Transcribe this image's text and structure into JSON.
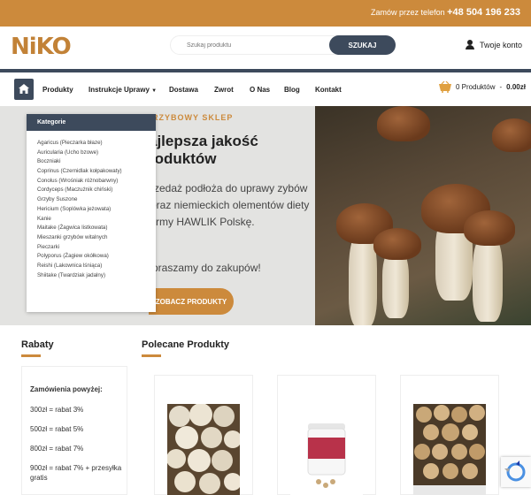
{
  "topbar": {
    "phone_label": "Zamów przez telefon",
    "phone_number": "+48 504 196 233"
  },
  "header": {
    "logo": "NiKO",
    "search_placeholder": "Szukaj produktu",
    "search_button": "SZUKAJ",
    "account_label": "Twoje konto",
    "icons": {
      "account": "user-icon"
    }
  },
  "nav": {
    "items": [
      "Produkty",
      "Instrukcje Uprawy",
      "Dostawa",
      "Zwrot",
      "O Nas",
      "Blog",
      "Kontakt"
    ],
    "cart_text": "0 Produktów",
    "cart_total": "0.00zł",
    "icons": {
      "home": "home-icon",
      "cart": "basket-icon",
      "dropdown": "chevron-down-icon"
    }
  },
  "categories": {
    "title": "Kategorie",
    "items": [
      "Agaricus (Pieczarka błaze)",
      "Auricularia (Ucho bzowe)",
      "Boczniaki",
      "Coprinus (Czernidlak kołpakowaty)",
      "Conolus (Wrośniak różnobarwny)",
      "Cordyceps (Maczużnik chiński)",
      "Grzyby Suszone",
      "Hericium (Soplówka jeżowata)",
      "Kanie",
      "Maitake (Żagwica listkowata)",
      "Mieszanki grzybów witalnych",
      "Pieczarki",
      "Polyporus (Żagiew okółkowa)",
      "Reishi (Lakownica lśniąca)",
      "Shiitake (Twardziak jadalny)"
    ]
  },
  "hero": {
    "label": "RZYBOWY SKLEP",
    "title": "ajlepsza jakość roduktów",
    "text": "rzedaż podłoża do uprawy zybów oraz niemieckich olementów diety firmy HAWLIK Polskę.",
    "invite": "praszamy do zakupów!",
    "button": "ZOBACZ PRODUKTY"
  },
  "discounts": {
    "title": "Rabaty",
    "heading": "Zamówienia powyżej:",
    "lines": [
      "300zł = rabat 3%",
      "500zł = rabat 5%",
      "800zł = rabat 7%",
      "900zł = rabat 7% + przesyłka gratis"
    ]
  },
  "featured": {
    "title": "Polecane Produkty"
  },
  "colors": {
    "accent": "#cc8a3c",
    "navy": "#3d4a5c"
  }
}
